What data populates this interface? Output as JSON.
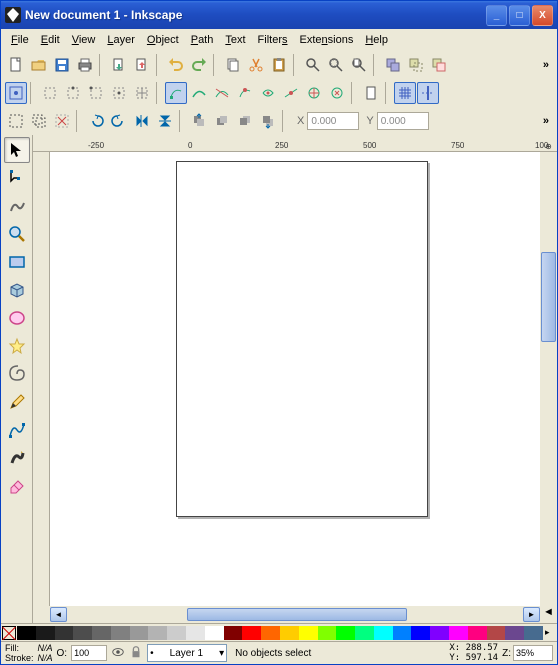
{
  "window": {
    "title": "New document 1 - Inkscape",
    "min": "_",
    "max": "□",
    "close": "X"
  },
  "menu": {
    "file": "File",
    "edit": "Edit",
    "view": "View",
    "layer": "Layer",
    "object": "Object",
    "path": "Path",
    "text": "Text",
    "filters": "Filters",
    "extensions": "Extensions",
    "help": "Help"
  },
  "toolbar_top": {
    "overflow": "»"
  },
  "tool_options": {
    "x_label": "X",
    "y_label": "Y",
    "x_value": "0.000",
    "y_value": "0.000",
    "overflow": "»"
  },
  "ruler": {
    "ticks": [
      "-250",
      "0",
      "250",
      "500",
      "750",
      "100"
    ],
    "unit_icon": "⊕"
  },
  "palette": {
    "colors": [
      "#000000",
      "#1a1a1a",
      "#333333",
      "#4d4d4d",
      "#666666",
      "#808080",
      "#999999",
      "#b3b3b3",
      "#cccccc",
      "#e6e6e6",
      "#ffffff",
      "#800000",
      "#ff0000",
      "#ff6600",
      "#ffcc00",
      "#ffff00",
      "#80ff00",
      "#00ff00",
      "#00ff80",
      "#00ffff",
      "#0080ff",
      "#0000ff",
      "#8000ff",
      "#ff00ff",
      "#ff0080",
      "#b34747",
      "#6b478f",
      "#476b8f"
    ],
    "arrow": "▸"
  },
  "status": {
    "fill_label": "Fill:",
    "stroke_label": "Stroke:",
    "fill_value": "N/A",
    "stroke_value": "N/A",
    "opacity_label": "O:",
    "opacity_value": "100",
    "layer_name": "Layer 1",
    "message": "No objects select",
    "x_label": "X:",
    "y_label": "Y:",
    "x_value": "288.57",
    "y_value": "597.14",
    "z_label": "Z:",
    "zoom_value": "35%"
  },
  "icons": {
    "arrow_play": "▸",
    "dropdown": "▾"
  }
}
